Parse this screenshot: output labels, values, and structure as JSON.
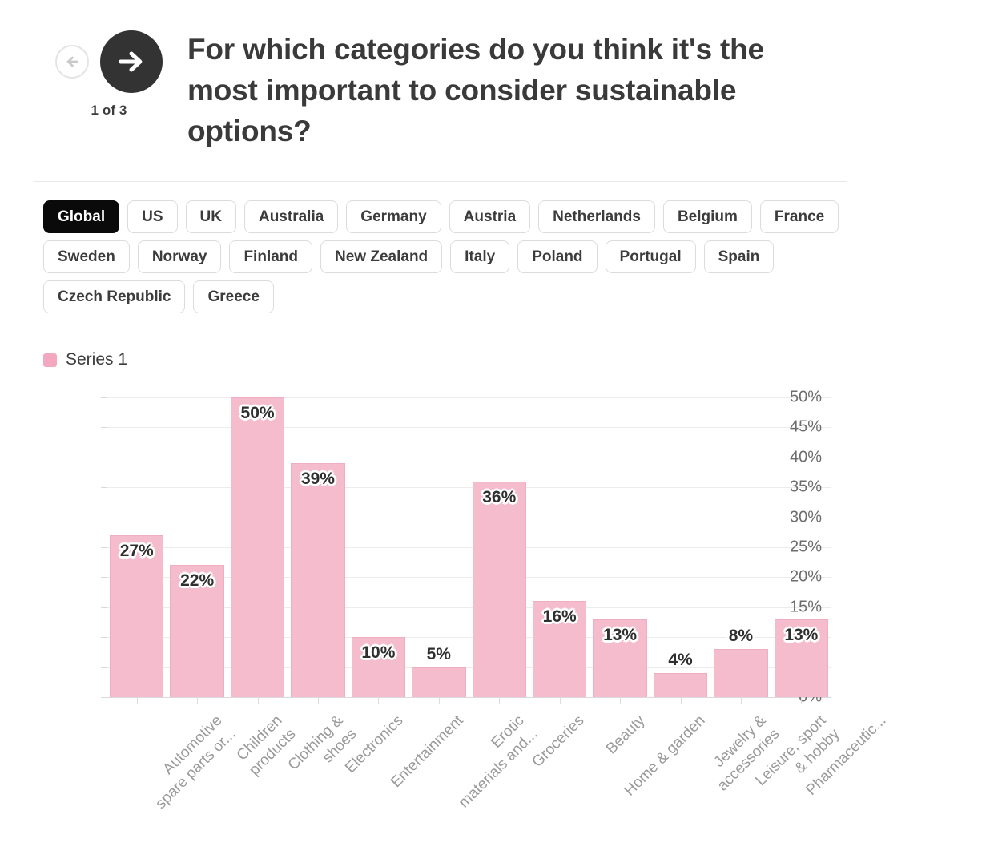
{
  "nav": {
    "prev_icon": "arrow-left-icon",
    "next_icon": "arrow-right-icon",
    "counter": "1 of 3"
  },
  "header": {
    "title": "For which categories do you think it's the most important to consider sustainable options?"
  },
  "filters": {
    "selected": "Global",
    "items": [
      "Global",
      "US",
      "UK",
      "Australia",
      "Germany",
      "Austria",
      "Netherlands",
      "Belgium",
      "France",
      "Sweden",
      "Norway",
      "Finland",
      "New Zealand",
      "Italy",
      "Poland",
      "Portugal",
      "Spain",
      "Czech Republic",
      "Greece"
    ]
  },
  "legend": {
    "label": "Series 1",
    "color": "#f4a8c0"
  },
  "chart_data": {
    "type": "bar",
    "title": "",
    "xlabel": "",
    "ylabel": "",
    "ylim": [
      0,
      50
    ],
    "ytick_labels": [
      "50%",
      "45%",
      "40%",
      "35%",
      "30%",
      "25%",
      "20%",
      "15%",
      "10%",
      "5%",
      "0%"
    ],
    "ytick_values": [
      50,
      45,
      40,
      35,
      30,
      25,
      20,
      15,
      10,
      5,
      0
    ],
    "grid": true,
    "legend_position": "top-left",
    "bar_color": "#f5bccd",
    "bar_border_color": "#f0aec2",
    "categories": [
      "Automotive\nspare parts or...",
      "Children\nproducts",
      "Clothing &\nshoes",
      "Electronics",
      "Entertainment",
      "Erotic\nmaterials and...",
      "Groceries",
      "Beauty",
      "Home & garden",
      "Jewelry &\naccessories",
      "Leisure, sport\n& hobby",
      "Pharmaceutic..."
    ],
    "series": [
      {
        "name": "Series 1",
        "values": [
          27,
          22,
          50,
          39,
          10,
          5,
          36,
          16,
          13,
          4,
          8,
          13
        ],
        "value_labels": [
          "27%",
          "22%",
          "50%",
          "39%",
          "10%",
          "5%",
          "36%",
          "16%",
          "13%",
          "4%",
          "8%",
          "13%"
        ]
      }
    ]
  }
}
